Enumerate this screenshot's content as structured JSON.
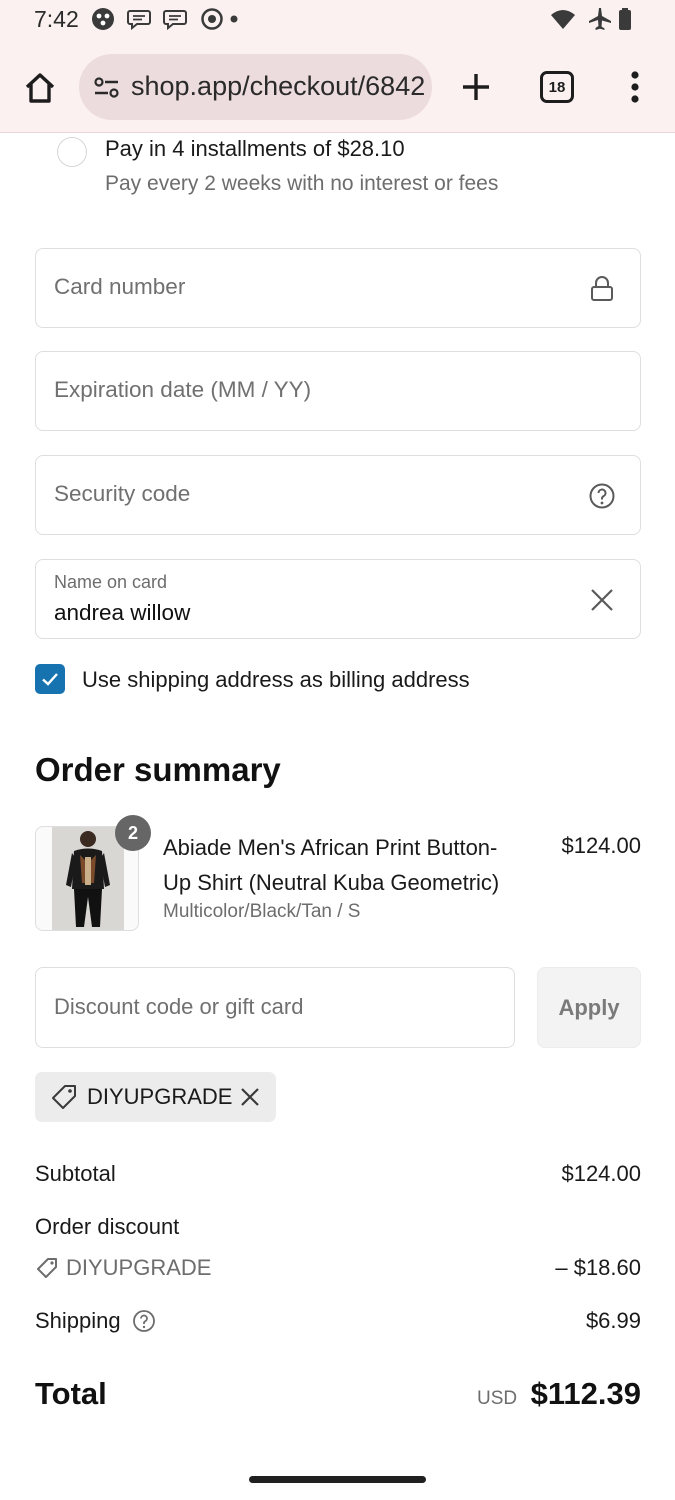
{
  "status_bar": {
    "time": "7:42"
  },
  "browser": {
    "url": "shop.app/checkout/6842",
    "tab_count": "18",
    "icons": [
      "home-icon",
      "site-settings-icon",
      "new-tab-icon",
      "tab-switcher-icon",
      "more-menu-icon"
    ]
  },
  "payment": {
    "installments": {
      "title": "Pay in 4 installments of $28.10",
      "subtitle": "Pay every 2 weeks with no interest or fees"
    },
    "card_number_placeholder": "Card number",
    "expiration_placeholder": "Expiration date (MM / YY)",
    "security_code_placeholder": "Security code",
    "name_on_card": {
      "label": "Name on card",
      "value": "andrea willow"
    },
    "billing_same": {
      "label": "Use shipping address as billing address",
      "checked": true
    }
  },
  "order_summary": {
    "title": "Order summary",
    "item": {
      "quantity": "2",
      "name": "Abiade Men's African Print Button-Up Shirt (Neutral Kuba Geometric)",
      "variant": "Multicolor/Black/Tan / S",
      "price": "$124.00"
    },
    "discount": {
      "placeholder": "Discount code or gift card",
      "apply_label": "Apply",
      "applied_code": "DIYUPGRADE"
    },
    "subtotal": {
      "label": "Subtotal",
      "value": "$124.00"
    },
    "order_discount": {
      "label": "Order discount",
      "code": "DIYUPGRADE",
      "value": "– $18.60"
    },
    "shipping": {
      "label": "Shipping",
      "value": "$6.99"
    },
    "total": {
      "label": "Total",
      "currency": "USD",
      "value": "$112.39"
    }
  },
  "colors": {
    "accent": "#1773b0",
    "chrome_bg": "#fbf1f1",
    "omnibox_bg": "#ecdcdd"
  }
}
